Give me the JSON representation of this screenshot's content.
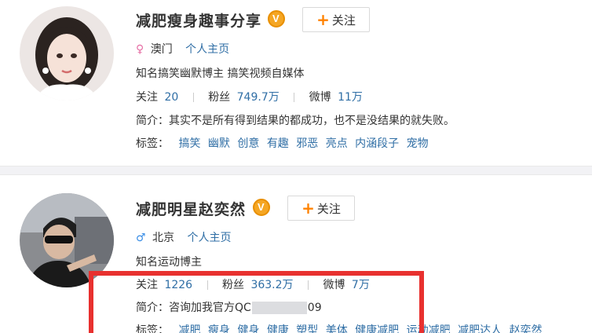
{
  "users": [
    {
      "name": "减肥瘦身趣事分享",
      "follow_label": "关注",
      "location": "澳门",
      "homepage_label": "个人主页",
      "description": "知名搞笑幽默博主 搞笑视频自媒体",
      "stats": {
        "follow_label": "关注",
        "follow_count": "20",
        "fans_label": "粉丝",
        "fans_count": "749.7万",
        "weibo_label": "微博",
        "weibo_count": "11万"
      },
      "intro_label": "简介：",
      "intro_text": "其实不是所有得到结果的都成功，也不是没结果的就失败。",
      "tags_label": "标签：",
      "tags": [
        "搞笑",
        "幽默",
        "创意",
        "有趣",
        "邪恶",
        "亮点",
        "内涵段子",
        "宠物"
      ],
      "gender": "female"
    },
    {
      "name": "减肥明星赵奕然",
      "follow_label": "关注",
      "location": "北京",
      "homepage_label": "个人主页",
      "description": "知名运动博主",
      "stats": {
        "follow_label": "关注",
        "follow_count": "1226",
        "fans_label": "粉丝",
        "fans_count": "363.2万",
        "weibo_label": "微博",
        "weibo_count": "7万"
      },
      "intro_label": "简介：",
      "intro_text_prefix": "咨询加我官方QC",
      "intro_text_suffix": "09",
      "tags_label": "标签：",
      "tags": [
        "减肥",
        "瘦身",
        "健身",
        "健康",
        "塑型",
        "美体",
        "健康减肥",
        "运动减肥",
        "减肥达人",
        "赵奕然"
      ],
      "gender": "male"
    }
  ],
  "colors": {
    "link": "#2f6ea5",
    "accent": "#ff8200",
    "highlight_box": "#e8312f",
    "female": "#e66fa5",
    "male": "#3a8ee6"
  }
}
